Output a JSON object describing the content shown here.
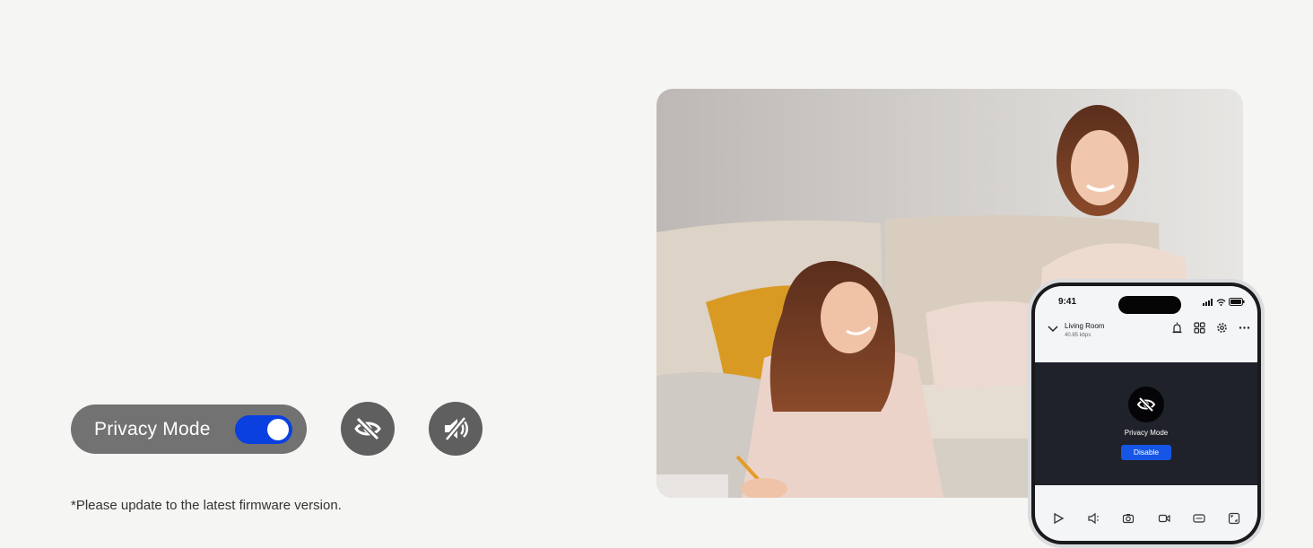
{
  "privacy_control": {
    "label": "Privacy Mode",
    "toggle_on": true,
    "toggle_color": "#0a3fe0"
  },
  "feature_icons": [
    {
      "name": "camera-off-icon"
    },
    {
      "name": "audio-muted-icon"
    }
  ],
  "note": "*Please update to the latest firmware version.",
  "phone": {
    "time": "9:41",
    "room_name": "Living Room",
    "bitrate": "40.85 kbps",
    "header_icons": [
      "alarm-icon",
      "grid-icon",
      "settings-icon",
      "more-icon"
    ],
    "privacy_label": "Privacy Mode",
    "disable_label": "Disable",
    "accent": "#1656e6",
    "controls": [
      "play-icon",
      "speaker-icon",
      "snapshot-icon",
      "record-icon",
      "quality-icon",
      "fullscreen-icon"
    ]
  }
}
